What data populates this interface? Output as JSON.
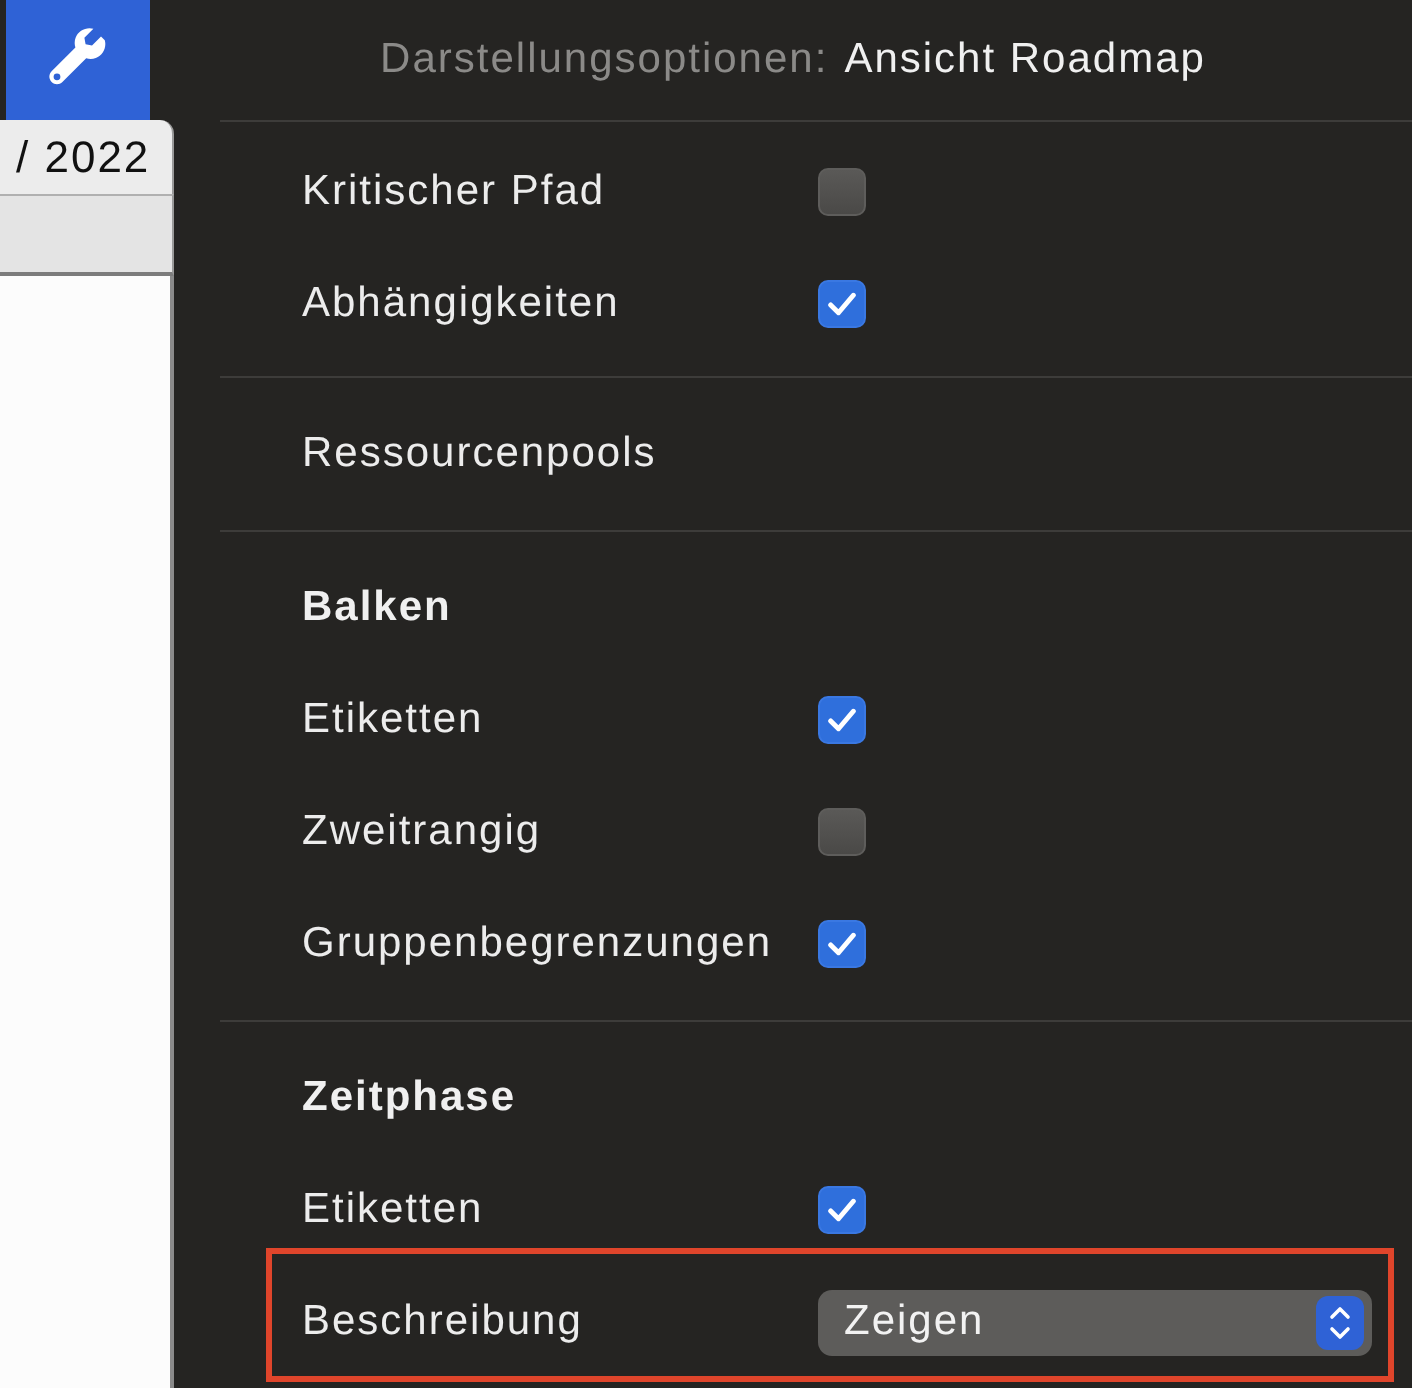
{
  "toolbar": {
    "inspector_button": {
      "selected": true
    }
  },
  "document": {
    "tab_label": "/ 2022"
  },
  "inspector": {
    "title_label": "Darstellungsoptionen:",
    "title_value": "Ansicht Roadmap",
    "sections": [
      {
        "items": [
          {
            "kind": "checkbox",
            "label": "Kritischer Pfad",
            "checked": false,
            "highlighted": false
          },
          {
            "kind": "checkbox",
            "label": "Abhängigkeiten",
            "checked": true,
            "highlighted": false
          }
        ]
      },
      {
        "items": [
          {
            "kind": "label",
            "label": "Ressourcenpools",
            "highlighted": false
          }
        ]
      },
      {
        "heading": "Balken",
        "items": [
          {
            "kind": "checkbox",
            "label": "Etiketten",
            "checked": true,
            "highlighted": false
          },
          {
            "kind": "checkbox",
            "label": "Zweitrangig",
            "checked": false,
            "highlighted": false
          },
          {
            "kind": "checkbox",
            "label": "Gruppenbegrenzungen",
            "checked": true,
            "highlighted": false
          }
        ]
      },
      {
        "heading": "Zeitphase",
        "items": [
          {
            "kind": "checkbox",
            "label": "Etiketten",
            "checked": true,
            "highlighted": false
          },
          {
            "kind": "dropdown",
            "label": "Beschreibung",
            "value": "Zeigen",
            "highlighted": true
          }
        ]
      }
    ]
  }
}
